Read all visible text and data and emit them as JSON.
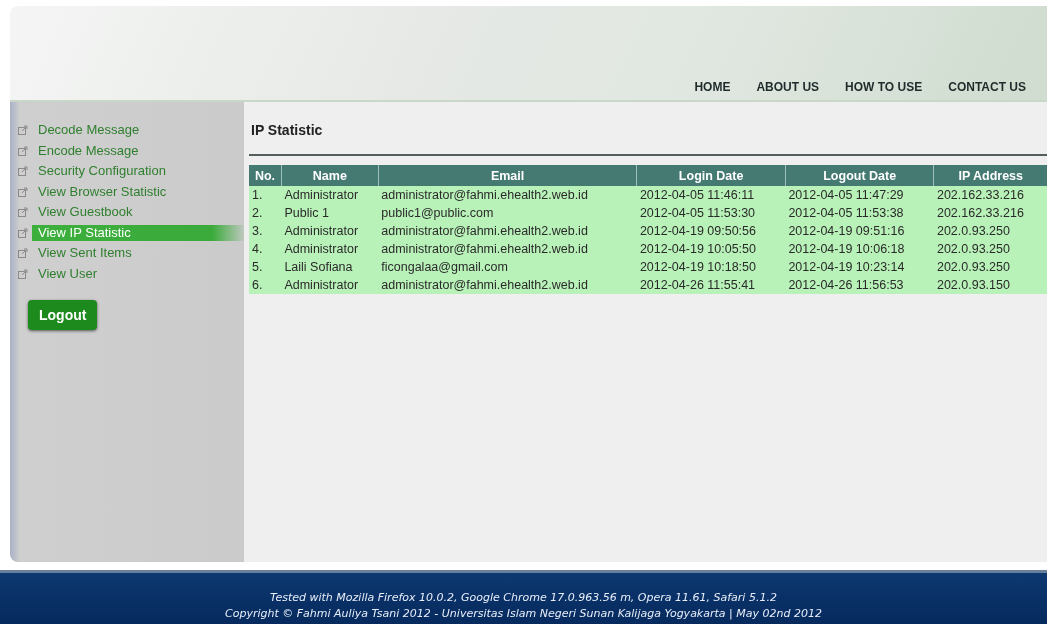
{
  "nav": [
    {
      "label": "HOME"
    },
    {
      "label": "ABOUT US"
    },
    {
      "label": "HOW TO USE"
    },
    {
      "label": "CONTACT US"
    }
  ],
  "sidebar": {
    "items": [
      {
        "label": "Decode Message",
        "selected": false
      },
      {
        "label": "Encode Message",
        "selected": false
      },
      {
        "label": "Security Configuration",
        "selected": false
      },
      {
        "label": "View Browser Statistic",
        "selected": false
      },
      {
        "label": "View Guestbook",
        "selected": false
      },
      {
        "label": "View IP Statistic",
        "selected": true
      },
      {
        "label": "View Sent Items",
        "selected": false
      },
      {
        "label": "View User",
        "selected": false
      }
    ],
    "logout": "Logout"
  },
  "page_title": "IP Statistic",
  "table": {
    "columns": [
      "No.",
      "Name",
      "Email",
      "Login Date",
      "Logout Date",
      "IP Address"
    ],
    "rows": [
      [
        "1.",
        "Administrator",
        "administrator@fahmi.ehealth2.web.id",
        "2012-04-05 11:46:11",
        "2012-04-05 11:47:29",
        "202.162.33.216"
      ],
      [
        "2.",
        "Public 1",
        "public1@public.com",
        "2012-04-05 11:53:30",
        "2012-04-05 11:53:38",
        "202.162.33.216"
      ],
      [
        "3.",
        "Administrator",
        "administrator@fahmi.ehealth2.web.id",
        "2012-04-19 09:50:56",
        "2012-04-19 09:51:16",
        "202.0.93.250"
      ],
      [
        "4.",
        "Administrator",
        "administrator@fahmi.ehealth2.web.id",
        "2012-04-19 10:05:50",
        "2012-04-19 10:06:18",
        "202.0.93.250"
      ],
      [
        "5.",
        "Laili Sofiana",
        "ficongalaa@gmail.com",
        "2012-04-19 10:18:50",
        "2012-04-19 10:23:14",
        "202.0.93.250"
      ],
      [
        "6.",
        "Administrator",
        "administrator@fahmi.ehealth2.web.id",
        "2012-04-26 11:55:41",
        "2012-04-26 11:56:53",
        "202.0.93.150"
      ]
    ]
  },
  "footer": [
    "Tested with Mozilla Firefox 10.0.2, Google Chrome 17.0.963.56 m, Opera 11.61, Safari 5.1.2",
    "Copyright © Fahmi Auliya Tsani 2012 - Universitas Islam Negeri Sunan Kalijaga Yogyakarta | May 02nd 2012"
  ]
}
